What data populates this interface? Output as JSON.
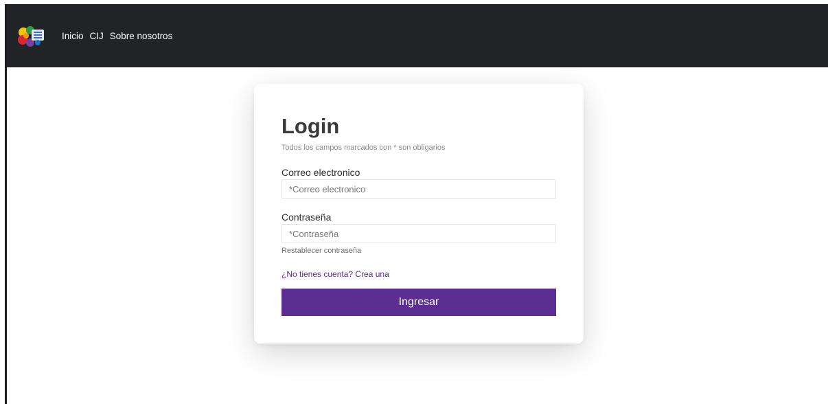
{
  "navbar": {
    "logo_icon": "flower-logo-icon",
    "links": [
      {
        "label": "Inicio"
      },
      {
        "label": "CIJ"
      },
      {
        "label": "Sobre nosotros"
      }
    ],
    "background": "#212327"
  },
  "login": {
    "title": "Login",
    "subtitle": "Todos los campos marcados con * son obligarios",
    "email": {
      "label": "Correo electronico",
      "value": "",
      "placeholder": "*Correo electronico"
    },
    "password": {
      "label": "Contraseña",
      "value": "",
      "placeholder": "*Contraseña"
    },
    "reset_link": "Restablecer contraseña",
    "signup_link": "¿No tienes cuenta? Crea una",
    "submit_label": "Ingresar"
  },
  "colors": {
    "accent": "#5b2e91",
    "navbar": "#212327"
  }
}
